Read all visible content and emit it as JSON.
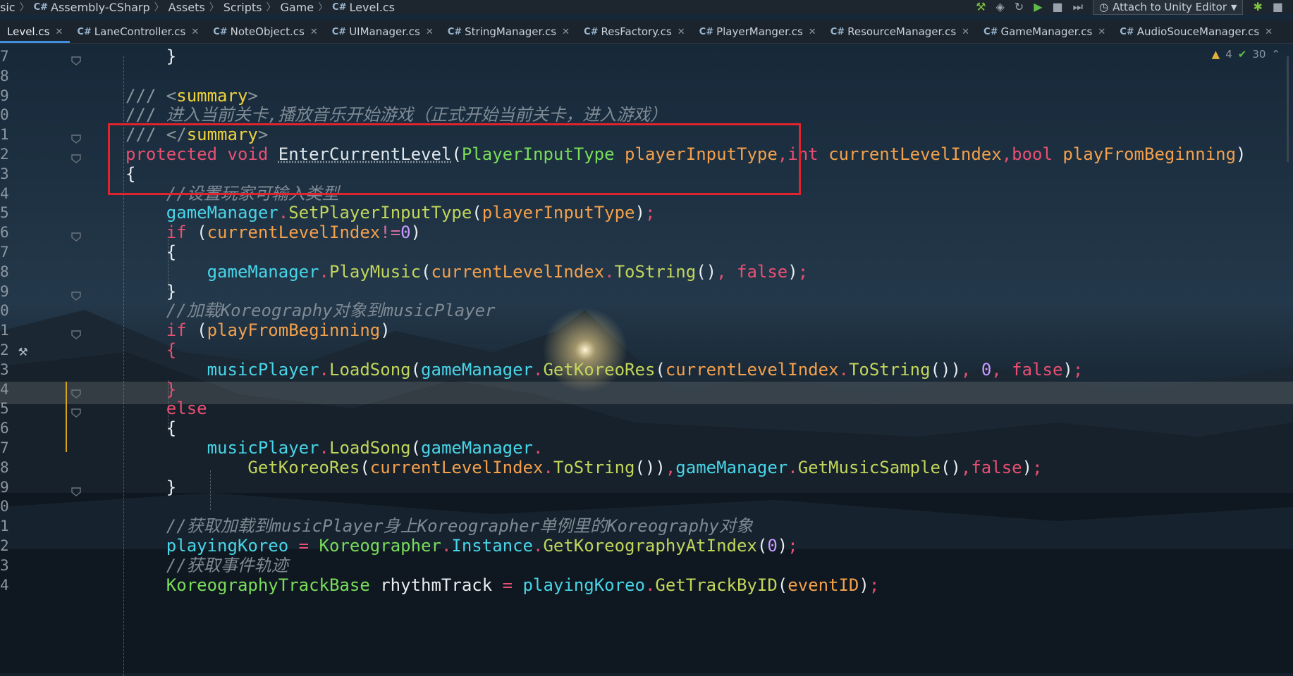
{
  "breadcrumb": [
    {
      "text": "sic",
      "cs": false
    },
    {
      "text": "Assembly-CSharp",
      "cs": true
    },
    {
      "text": "Assets",
      "cs": false
    },
    {
      "text": "Scripts",
      "cs": false
    },
    {
      "text": "Game",
      "cs": false
    },
    {
      "text": "Level.cs",
      "cs": true
    }
  ],
  "toolbar": {
    "attach_label": "Attach to Unity Editor",
    "cs_badge": "C#"
  },
  "tabs": [
    {
      "label": "Level.cs",
      "active": true,
      "cs": false
    },
    {
      "label": "LaneController.cs",
      "active": false,
      "cs": true
    },
    {
      "label": "NoteObject.cs",
      "active": false,
      "cs": true
    },
    {
      "label": "UIManager.cs",
      "active": false,
      "cs": true
    },
    {
      "label": "StringManager.cs",
      "active": false,
      "cs": true
    },
    {
      "label": "ResFactory.cs",
      "active": false,
      "cs": true
    },
    {
      "label": "PlayerManger.cs",
      "active": false,
      "cs": true
    },
    {
      "label": "ResourceManager.cs",
      "active": false,
      "cs": true
    },
    {
      "label": "GameManager.cs",
      "active": false,
      "cs": true
    },
    {
      "label": "AudioSouceManager.cs",
      "active": false,
      "cs": true
    }
  ],
  "inspection": {
    "warnings": "4",
    "checks": "30"
  },
  "lines": [
    {
      "n": "7",
      "tokens": [
        [
          "pu",
          "    }"
        ]
      ]
    },
    {
      "n": "8",
      "tokens": []
    },
    {
      "n": "9",
      "tokens": [
        [
          "cg",
          "/// "
        ],
        [
          "cg",
          "<"
        ],
        [
          "tag",
          "summary"
        ],
        [
          "cg",
          ">"
        ]
      ]
    },
    {
      "n": "0",
      "tokens": [
        [
          "cg",
          "/// "
        ],
        [
          "c",
          "进入当前关卡,播放音乐开始游戏（正式开始当前关卡，进入游戏）"
        ]
      ]
    },
    {
      "n": "1",
      "tokens": [
        [
          "cg",
          "/// "
        ],
        [
          "cg",
          "</"
        ],
        [
          "tag",
          "summary"
        ],
        [
          "cg",
          ">"
        ]
      ]
    },
    {
      "n": "2",
      "tokens": [
        [
          "kw",
          "protected"
        ],
        [
          "pu",
          " "
        ],
        [
          "kw",
          "void"
        ],
        [
          "pu",
          " "
        ],
        [
          "fnd",
          "EnterCurrentLevel"
        ],
        [
          "pu",
          "("
        ],
        [
          "ty",
          "PlayerInputType"
        ],
        [
          "pu",
          " "
        ],
        [
          "pr",
          "playerInputType"
        ],
        [
          "kw",
          ","
        ],
        [
          "kw",
          "int"
        ],
        [
          "pu",
          " "
        ],
        [
          "pr",
          "currentLevelIndex"
        ],
        [
          "kw",
          ","
        ],
        [
          "kw",
          "bool"
        ],
        [
          "pu",
          " "
        ],
        [
          "pr",
          "playFromBeginning"
        ],
        [
          "pu",
          ")"
        ]
      ]
    },
    {
      "n": "3",
      "tokens": [
        [
          "pu",
          "{"
        ]
      ]
    },
    {
      "n": "4",
      "tokens": [
        [
          "pu",
          "    "
        ],
        [
          "c",
          "//设置玩家可输入类型"
        ]
      ]
    },
    {
      "n": "5",
      "tokens": [
        [
          "pu",
          "    "
        ],
        [
          "vr",
          "gameManager"
        ],
        [
          "kw",
          "."
        ],
        [
          "fn",
          "SetPlayerInputType"
        ],
        [
          "pu",
          "("
        ],
        [
          "pr",
          "playerInputType"
        ],
        [
          "pu",
          ")"
        ],
        [
          "semi",
          ";"
        ]
      ]
    },
    {
      "n": "6",
      "tokens": [
        [
          "pu",
          "    "
        ],
        [
          "kw",
          "if"
        ],
        [
          "pu",
          " ("
        ],
        [
          "pr",
          "currentLevelIndex"
        ],
        [
          "op",
          "!="
        ],
        [
          "nm",
          "0"
        ],
        [
          "pu",
          ")"
        ]
      ]
    },
    {
      "n": "7",
      "tokens": [
        [
          "pu",
          "    {"
        ]
      ]
    },
    {
      "n": "8",
      "tokens": [
        [
          "pu",
          "        "
        ],
        [
          "vr",
          "gameManager"
        ],
        [
          "kw",
          "."
        ],
        [
          "fn",
          "PlayMusic"
        ],
        [
          "pu",
          "("
        ],
        [
          "pr",
          "currentLevelIndex"
        ],
        [
          "kw",
          "."
        ],
        [
          "fn",
          "ToString"
        ],
        [
          "pu",
          "()"
        ],
        [
          "kw",
          ","
        ],
        [
          "pu",
          " "
        ],
        [
          "kw",
          "false"
        ],
        [
          "pu",
          ")"
        ],
        [
          "semi",
          ";"
        ]
      ]
    },
    {
      "n": "9",
      "tokens": [
        [
          "pu",
          "    }"
        ]
      ]
    },
    {
      "n": "0",
      "tokens": [
        [
          "pu",
          "    "
        ],
        [
          "c",
          "//加载Koreography对象到musicPlayer"
        ]
      ]
    },
    {
      "n": "1",
      "tokens": [
        [
          "pu",
          "    "
        ],
        [
          "kw",
          "if"
        ],
        [
          "pu",
          " ("
        ],
        [
          "pr",
          "playFromBeginning"
        ],
        [
          "pu",
          ")"
        ]
      ]
    },
    {
      "n": "2",
      "tokens": [
        [
          "pu",
          "    "
        ],
        [
          "kw",
          "{"
        ]
      ]
    },
    {
      "n": "3",
      "tokens": [
        [
          "pu",
          "        "
        ],
        [
          "vr",
          "musicPlayer"
        ],
        [
          "kw",
          "."
        ],
        [
          "fn",
          "LoadSong"
        ],
        [
          "pu",
          "("
        ],
        [
          "vr",
          "gameManager"
        ],
        [
          "kw",
          "."
        ],
        [
          "fn",
          "GetKoreoRes"
        ],
        [
          "pu",
          "("
        ],
        [
          "pr",
          "currentLevelIndex"
        ],
        [
          "kw",
          "."
        ],
        [
          "fn",
          "ToString"
        ],
        [
          "pu",
          "())"
        ],
        [
          "kw",
          ","
        ],
        [
          "pu",
          " "
        ],
        [
          "nm",
          "0"
        ],
        [
          "kw",
          ","
        ],
        [
          "pu",
          " "
        ],
        [
          "kw",
          "false"
        ],
        [
          "pu",
          ")"
        ],
        [
          "semi",
          ";"
        ]
      ]
    },
    {
      "n": "4",
      "tokens": [
        [
          "pu",
          "    "
        ],
        [
          "kw",
          "}"
        ]
      ]
    },
    {
      "n": "5",
      "tokens": [
        [
          "pu",
          "    "
        ],
        [
          "kw",
          "else"
        ]
      ]
    },
    {
      "n": "6",
      "tokens": [
        [
          "pu",
          "    {"
        ]
      ]
    },
    {
      "n": "7",
      "tokens": [
        [
          "pu",
          "        "
        ],
        [
          "vr",
          "musicPlayer"
        ],
        [
          "kw",
          "."
        ],
        [
          "fn",
          "LoadSong"
        ],
        [
          "pu",
          "("
        ],
        [
          "vr",
          "gameManager"
        ],
        [
          "kw",
          "."
        ]
      ]
    },
    {
      "n": "8",
      "tokens": [
        [
          "pu",
          "            "
        ],
        [
          "fn",
          "GetKoreoRes"
        ],
        [
          "pu",
          "("
        ],
        [
          "pr",
          "currentLevelIndex"
        ],
        [
          "kw",
          "."
        ],
        [
          "fn",
          "ToString"
        ],
        [
          "pu",
          "())"
        ],
        [
          "kw",
          ","
        ],
        [
          "vr",
          "gameManager"
        ],
        [
          "kw",
          "."
        ],
        [
          "fn",
          "GetMusicSample"
        ],
        [
          "pu",
          "()"
        ],
        [
          "kw",
          ","
        ],
        [
          "kw",
          "false"
        ],
        [
          "pu",
          ")"
        ],
        [
          "semi",
          ";"
        ]
      ]
    },
    {
      "n": "9",
      "tokens": [
        [
          "pu",
          "    }"
        ]
      ]
    },
    {
      "n": "0",
      "tokens": []
    },
    {
      "n": "1",
      "tokens": [
        [
          "pu",
          "    "
        ],
        [
          "c",
          "//获取加载到musicPlayer身上Koreographer单例里的Koreography对象"
        ]
      ]
    },
    {
      "n": "2",
      "tokens": [
        [
          "pu",
          "    "
        ],
        [
          "vr",
          "playingKoreo"
        ],
        [
          "pu",
          " "
        ],
        [
          "kw",
          "="
        ],
        [
          "pu",
          " "
        ],
        [
          "ty",
          "Koreographer"
        ],
        [
          "kw",
          "."
        ],
        [
          "vr",
          "Instance"
        ],
        [
          "kw",
          "."
        ],
        [
          "fn",
          "GetKoreographyAtIndex"
        ],
        [
          "pu",
          "("
        ],
        [
          "nm",
          "0"
        ],
        [
          "pu",
          ")"
        ],
        [
          "semi",
          ";"
        ]
      ]
    },
    {
      "n": "3",
      "tokens": [
        [
          "pu",
          "    "
        ],
        [
          "c",
          "//获取事件轨迹"
        ]
      ]
    },
    {
      "n": "4",
      "tokens": [
        [
          "pu",
          "    "
        ],
        [
          "ty",
          "KoreographyTrackBase"
        ],
        [
          "pu",
          " "
        ],
        [
          "pu",
          "rhythmTrack"
        ],
        [
          "pu",
          " "
        ],
        [
          "kw",
          "="
        ],
        [
          "pu",
          " "
        ],
        [
          "vr",
          "playingKoreo"
        ],
        [
          "kw",
          "."
        ],
        [
          "fn",
          "GetTrackByID"
        ],
        [
          "pu",
          "("
        ],
        [
          "pr",
          "eventID"
        ],
        [
          "pu",
          ")"
        ],
        [
          "semi",
          ";"
        ]
      ]
    }
  ]
}
